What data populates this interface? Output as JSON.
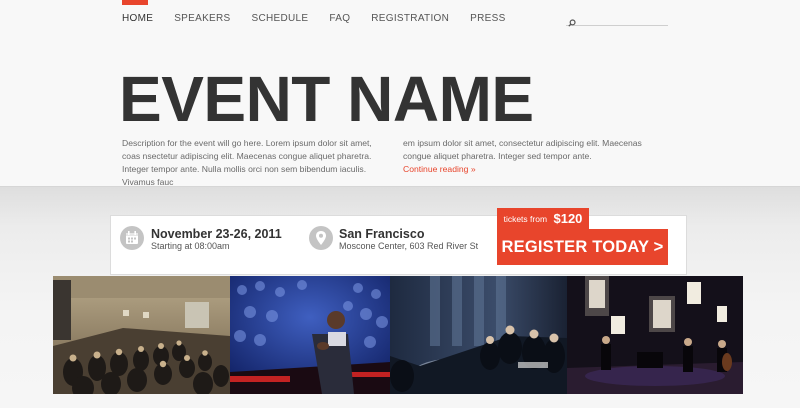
{
  "nav": {
    "items": [
      {
        "label": "HOME",
        "active": true
      },
      {
        "label": "SPEAKERS",
        "active": false
      },
      {
        "label": "SCHEDULE",
        "active": false
      },
      {
        "label": "FAQ",
        "active": false
      },
      {
        "label": "REGISTRATION",
        "active": false
      },
      {
        "label": "PRESS",
        "active": false
      }
    ],
    "active_marker_color": "#e8452c"
  },
  "search": {
    "placeholder": "",
    "icon": "search-icon"
  },
  "hero": {
    "title": "EVENT NAME",
    "description_col1": "Description for the event will go here. Lorem ipsum dolor sit amet, coas nsectetur adipiscing elit. Maecenas congue aliquet pharetra. Integer tempor ante. Nulla mollis orci non sem bibendum iaculis. Vivamus fauc",
    "description_col2": "em ipsum dolor sit amet, consectetur adipiscing elit. Maecenas congue aliquet pharetra. Integer sed tempor ante.",
    "continue_link": "Continue reading »"
  },
  "event_info": {
    "date": "November 23-26, 2011",
    "time": "Starting at 08:00am",
    "date_icon": "calendar-icon",
    "city": "San Francisco",
    "venue": "Moscone Center, 603 Red River St",
    "location_icon": "map-pin-icon"
  },
  "tickets": {
    "from_label": "tickets from",
    "price": "$120",
    "register_label": "REGISTER TODAY >",
    "accent_color": "#e8452c"
  },
  "gallery": {
    "photos": [
      {
        "alt": "audience seated in a conference hall"
      },
      {
        "alt": "speaker on stage in front of a crowd"
      },
      {
        "alt": "audience seated in a dark venue"
      },
      {
        "alt": "musicians performing on a lit stage"
      }
    ]
  }
}
